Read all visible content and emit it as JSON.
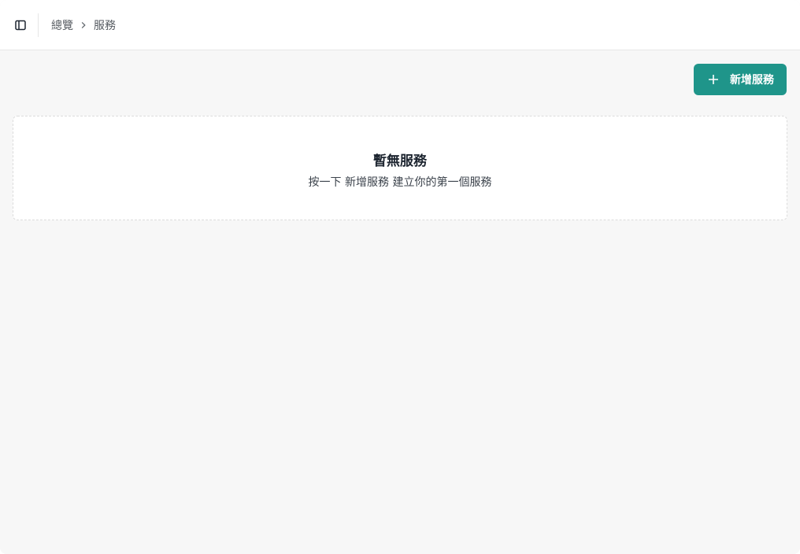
{
  "header": {
    "sidebar_toggle_icon": "sidebar-panel-icon",
    "breadcrumb": {
      "home": "總覽",
      "separator_icon": "chevron-right-icon",
      "current": "服務"
    }
  },
  "toolbar": {
    "add_button_label": "新增服務",
    "add_button_icon": "plus-icon",
    "accent_color": "#1f958a"
  },
  "empty_state": {
    "title": "暫無服務",
    "description": "按一下 新增服務 建立你的第一個服務"
  }
}
